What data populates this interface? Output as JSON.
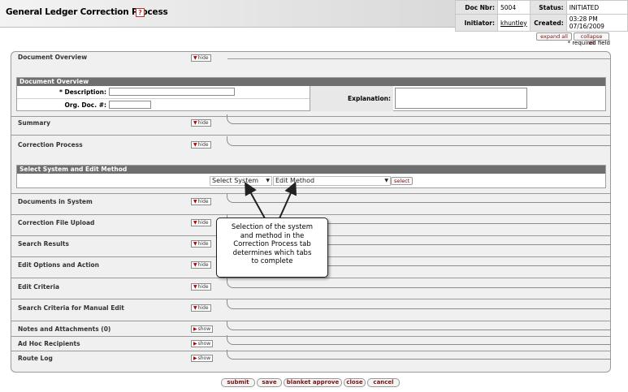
{
  "header": {
    "title": "General Ledger Correction Process",
    "help_icon": "?",
    "doc_nbr_label": "Doc Nbr:",
    "doc_nbr": "5004",
    "status_label": "Status:",
    "status": "INITIATED",
    "initiator_label": "Initiator:",
    "initiator": "khuntley",
    "created_label": "Created:",
    "created": "03:28 PM 07/16/2009"
  },
  "top_controls": {
    "expand_all": "expand all",
    "collapse_all": "collapse all",
    "required_note": "* required field"
  },
  "tabs": [
    {
      "label": "Document Overview",
      "toggle": "hide"
    },
    {
      "label": "Summary",
      "toggle": "hide"
    },
    {
      "label": "Correction Process",
      "toggle": "hide"
    },
    {
      "label": "Documents in System",
      "toggle": "hide"
    },
    {
      "label": "Correction File Upload",
      "toggle": "hide"
    },
    {
      "label": "Search Results",
      "toggle": "hide"
    },
    {
      "label": "Edit Options and Action",
      "toggle": "hide"
    },
    {
      "label": "Edit Criteria",
      "toggle": "hide"
    },
    {
      "label": "Search Criteria for Manual Edit",
      "toggle": "hide"
    },
    {
      "label": "Notes and Attachments (0)",
      "toggle": "show"
    },
    {
      "label": "Ad Hoc Recipients",
      "toggle": "show"
    },
    {
      "label": "Route Log",
      "toggle": "show"
    }
  ],
  "document_overview": {
    "header": "Document Overview",
    "description_label": "* Description:",
    "description_value": "",
    "org_doc_label": "Org. Doc. #:",
    "org_doc_value": "",
    "explanation_label": "Explanation:",
    "explanation_value": ""
  },
  "select_system": {
    "header": "Select System and Edit Method",
    "system_select": "Select System",
    "edit_method_select": "Edit Method",
    "select_button": "select"
  },
  "callout": {
    "text_lines": [
      "Selection of the system",
      "and method in the",
      "Correction Process tab",
      "determines which tabs",
      "to complete"
    ]
  },
  "bottom_buttons": [
    "submit",
    "save",
    "blanket approve",
    "close",
    "cancel"
  ]
}
